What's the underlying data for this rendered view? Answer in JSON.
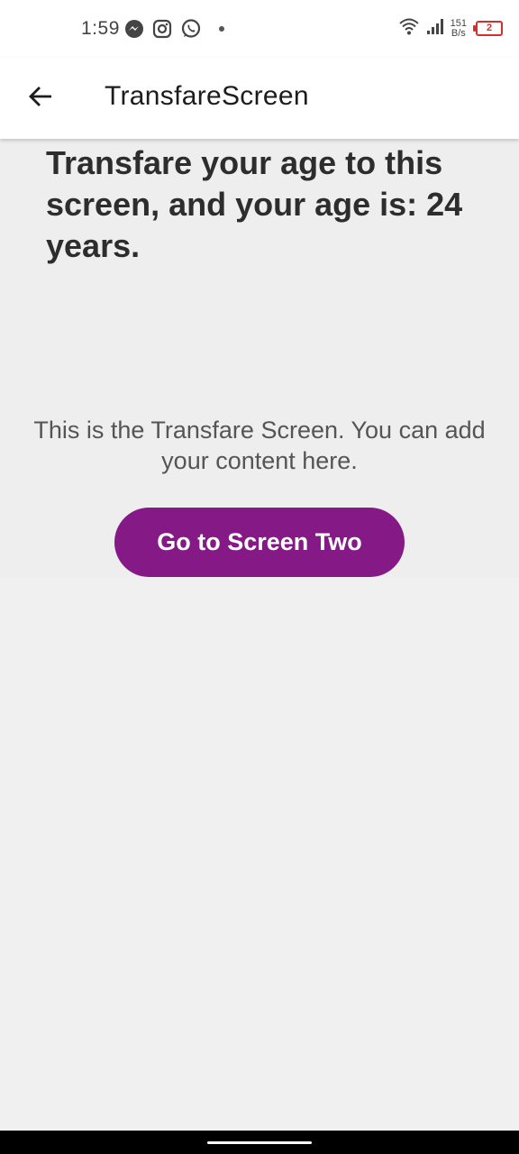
{
  "status_bar": {
    "time": "1:59",
    "net_speed_value": "151",
    "net_speed_unit": "B/s",
    "battery_level": "2",
    "icons": [
      "messenger-icon",
      "instagram-icon",
      "whatsapp-icon",
      "dot-icon",
      "wifi-icon",
      "signal-icon",
      "battery-icon"
    ]
  },
  "app_bar": {
    "title": "TransfareScreen",
    "back_icon": "arrow-back-icon"
  },
  "main": {
    "heading": "Transfare your age to this screen, and your age is: 24 years.",
    "description": "This is the Transfare Screen. You can add your content here.",
    "button_label": "Go to Screen Two"
  },
  "colors": {
    "accent": "#851a86",
    "background": "#f0f0f0",
    "battery_low": "#d32f2f"
  }
}
